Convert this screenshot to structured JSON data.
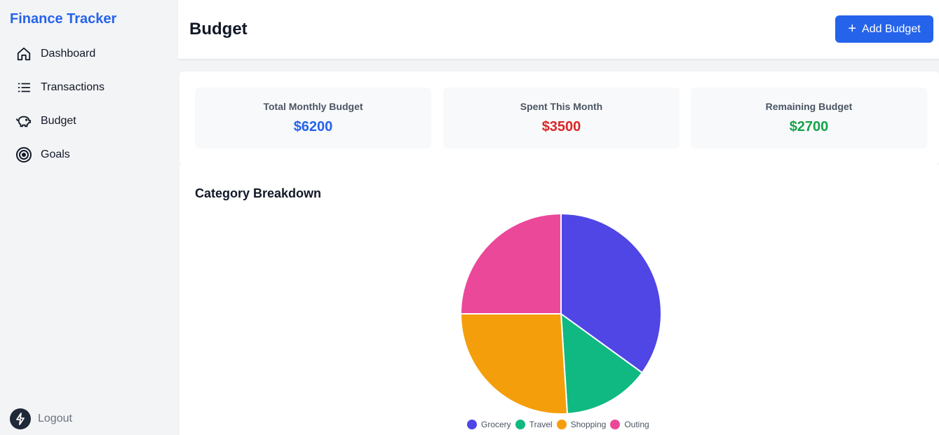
{
  "app": {
    "brand": "Finance Tracker"
  },
  "sidebar": {
    "items": [
      {
        "label": "Dashboard",
        "icon": "home-icon"
      },
      {
        "label": "Transactions",
        "icon": "list-icon"
      },
      {
        "label": "Budget",
        "icon": "piggy-bank-icon"
      },
      {
        "label": "Goals",
        "icon": "target-icon"
      }
    ],
    "logout": {
      "label": "Logout",
      "icon": "bolt-icon"
    }
  },
  "header": {
    "title": "Budget",
    "add_button_label": "Add Budget",
    "add_button_icon": "plus-icon"
  },
  "summary": {
    "cards": [
      {
        "label": "Total Monthly Budget",
        "value": "$6200",
        "color": "#2563eb"
      },
      {
        "label": "Spent This Month",
        "value": "$3500",
        "color": "#dc2626"
      },
      {
        "label": "Remaining Budget",
        "value": "$2700",
        "color": "#16a34a"
      }
    ]
  },
  "breakdown": {
    "title": "Category Breakdown"
  },
  "chart_data": {
    "type": "pie",
    "categories": [
      "Grocery",
      "Travel",
      "Shopping",
      "Outing"
    ],
    "values": [
      35,
      14,
      26,
      25
    ],
    "colors": [
      "#4f46e5",
      "#10b981",
      "#f59e0b",
      "#ec4899"
    ],
    "legend": "bottom"
  }
}
